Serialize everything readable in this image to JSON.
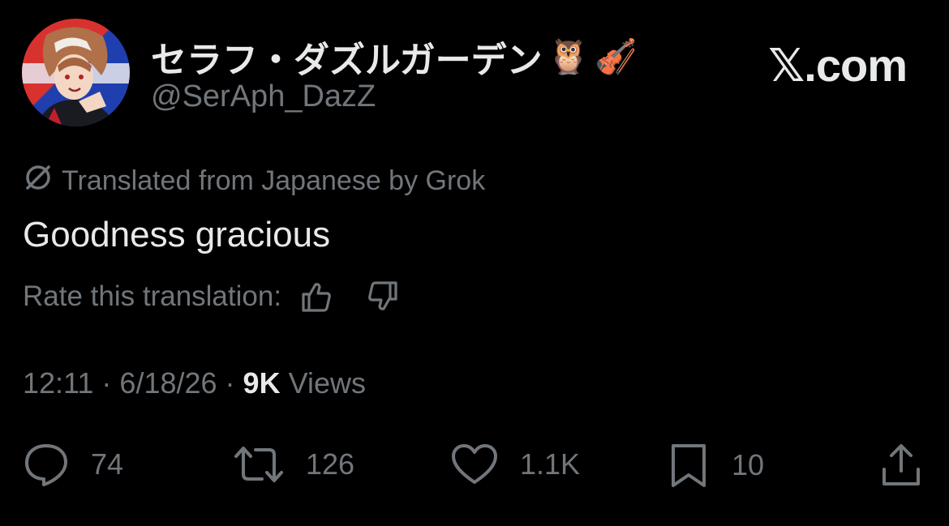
{
  "author": {
    "display_name": "セラフ・ダズルガーデン",
    "emojis": [
      "🦉",
      "🎻"
    ],
    "handle": "@SerAph_DazZ"
  },
  "brand": "𝕏.com",
  "translation_notice": "Translated from Japanese by Grok",
  "text": "Goodness gracious",
  "rate_prompt": "Rate this translation:",
  "meta": {
    "time": "12:11",
    "separator1": " · ",
    "date": "6/18/26",
    "separator2": " · ",
    "views_count": "9K",
    "views_label": " Views"
  },
  "actions": {
    "replies": "74",
    "reposts": "126",
    "likes": "1.1K",
    "bookmarks": "10"
  },
  "icons": [
    "avatar",
    "translate-icon",
    "thumbs-up-icon",
    "thumbs-down-icon",
    "reply-icon",
    "repost-icon",
    "like-icon",
    "bookmark-icon",
    "share-icon"
  ]
}
